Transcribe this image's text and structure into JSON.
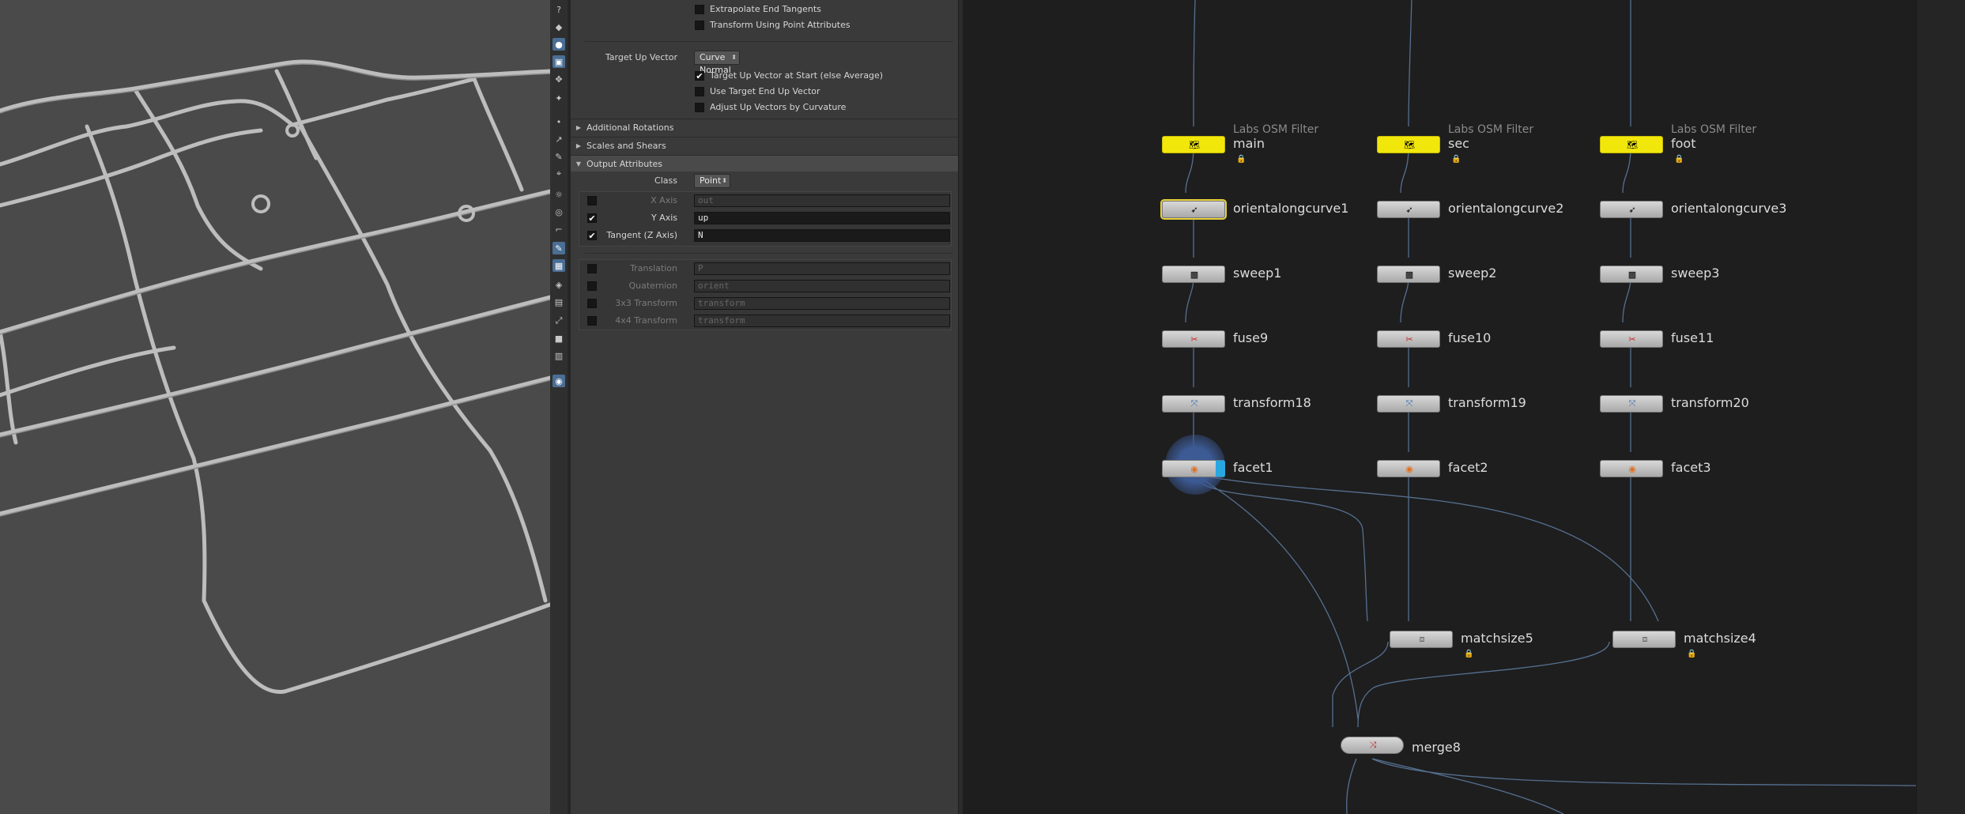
{
  "parameters": {
    "extrapolate_end_tangents": "Extrapolate End Tangents",
    "transform_using_point_attributes": "Transform Using Point Attributes",
    "target_up_vector_label": "Target Up Vector",
    "target_up_vector_value": "Curve Normal",
    "target_up_at_start": "Target Up Vector at Start (else Average)",
    "use_target_end_up": "Use Target End Up Vector",
    "adjust_up_vectors": "Adjust Up Vectors by Curvature",
    "folder_additional_rotations": "Additional Rotations",
    "folder_scales_shears": "Scales and Shears",
    "folder_output_attributes": "Output Attributes",
    "class_label": "Class",
    "class_value": "Point",
    "x_axis_label": "X Axis",
    "x_axis_value": "out",
    "y_axis_label": "Y Axis",
    "y_axis_value": "up",
    "tangent_label": "Tangent (Z Axis)",
    "tangent_value": "N",
    "translation_label": "Translation",
    "translation_value": "P",
    "quaternion_label": "Quaternion",
    "quaternion_value": "orient",
    "transform3_label": "3x3 Transform",
    "transform3_value": "transform",
    "transform4_label": "4x4 Transform",
    "transform4_value": "transform"
  },
  "network": {
    "filter_type": "Labs OSM Filter",
    "col1": {
      "filter": "main",
      "orient": "orientalongcurve1",
      "sweep": "sweep1",
      "fuse": "fuse9",
      "transform": "transform18",
      "facet": "facet1"
    },
    "col2": {
      "filter": "sec",
      "orient": "orientalongcurve2",
      "sweep": "sweep2",
      "fuse": "fuse10",
      "transform": "transform19",
      "facet": "facet2"
    },
    "col3": {
      "filter": "foot",
      "orient": "orientalongcurve3",
      "sweep": "sweep3",
      "fuse": "fuse11",
      "transform": "transform20",
      "facet": "facet3"
    },
    "matchsize5": "matchsize5",
    "matchsize4": "matchsize4",
    "merge": "merge8"
  },
  "colors": {
    "filter_node": "#f2e70a",
    "selected": "#e6d23a",
    "viewport_bg": "#4a4a4a",
    "network_bg": "#1e1e1f"
  }
}
